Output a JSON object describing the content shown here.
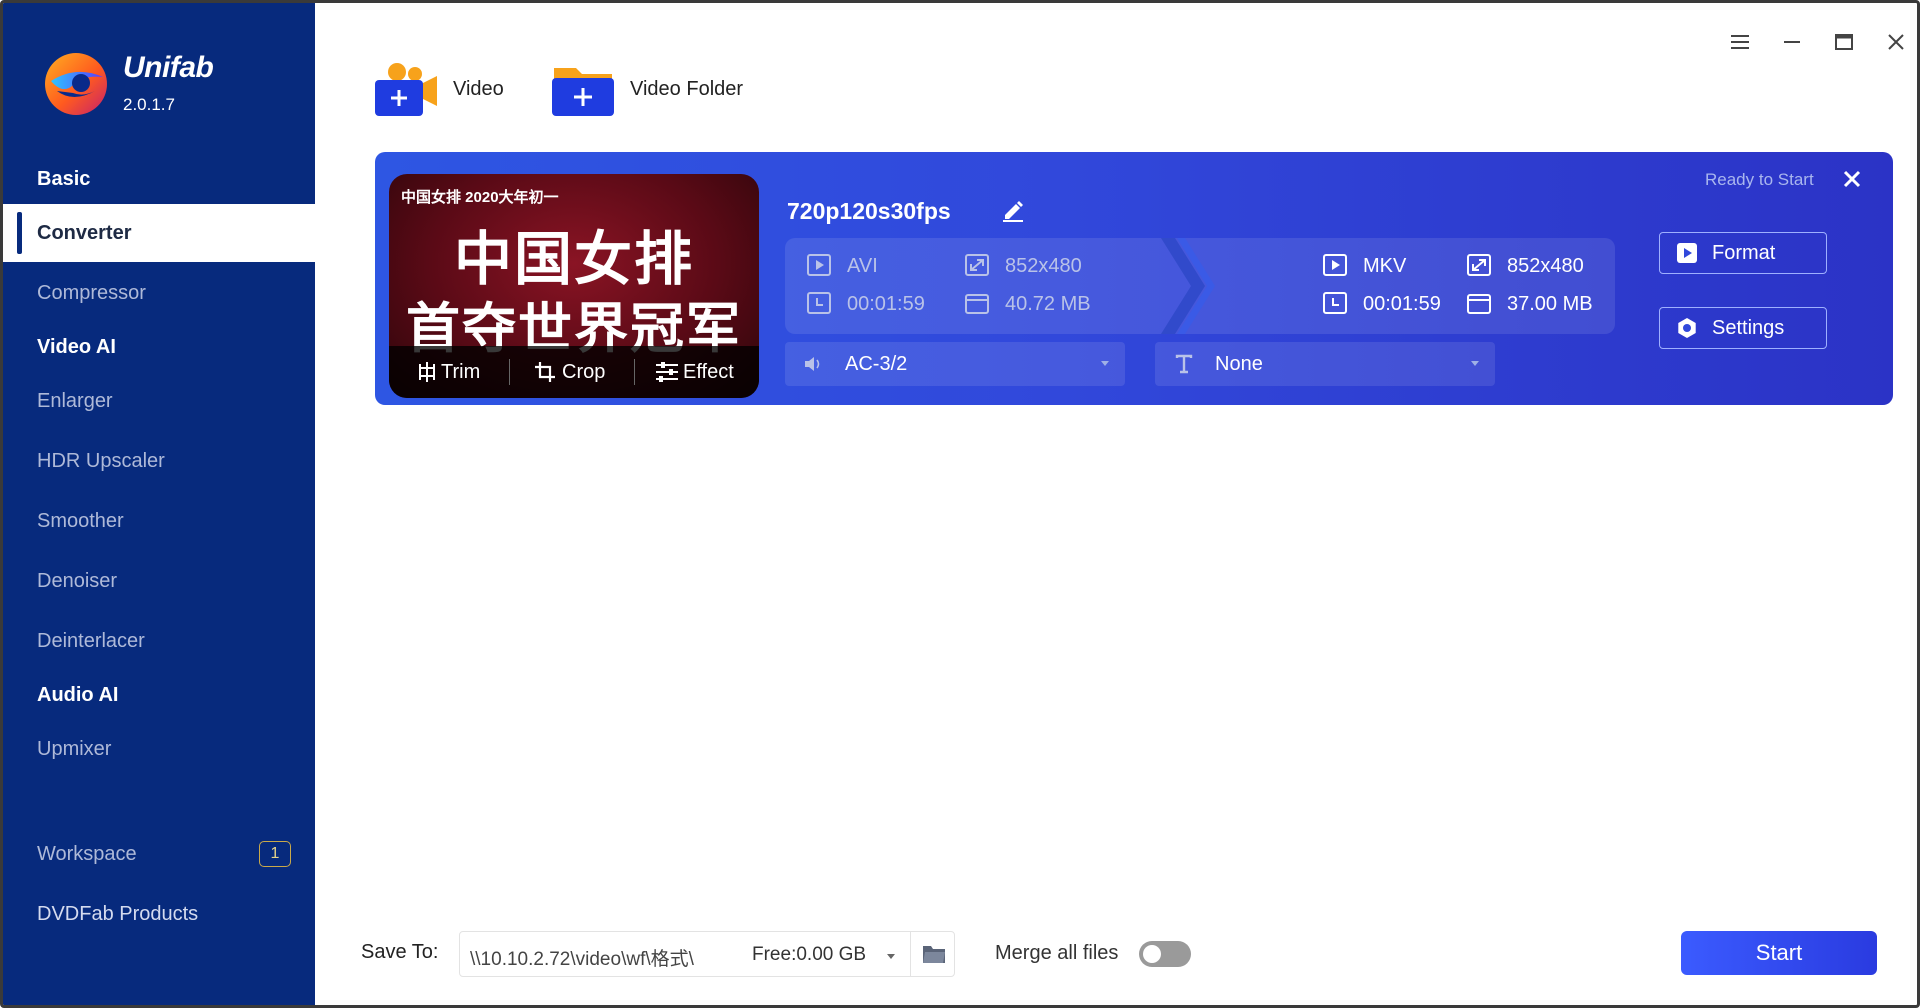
{
  "app": {
    "name": "Unifab",
    "version": "2.0.1.7"
  },
  "sidebar": {
    "sections": [
      {
        "label": "Basic"
      },
      {
        "label": "Video AI"
      },
      {
        "label": "Audio AI"
      }
    ],
    "items": [
      {
        "label": "Converter",
        "active": true
      },
      {
        "label": "Compressor"
      },
      {
        "label": "Enlarger"
      },
      {
        "label": "HDR Upscaler"
      },
      {
        "label": "Smoother"
      },
      {
        "label": "Denoiser"
      },
      {
        "label": "Deinterlacer"
      },
      {
        "label": "Upmixer"
      },
      {
        "label": "Workspace",
        "badge": "1"
      },
      {
        "label": "DVDFab Products"
      }
    ]
  },
  "toolbar": {
    "add_video_label": "Video",
    "add_folder_label": "Video Folder"
  },
  "task": {
    "thumbnail": {
      "top_caption": "中国女排 2020大年初一",
      "headline_1": "中国女排",
      "headline_2": "首夺世界冠军"
    },
    "thumb_actions": {
      "trim": "Trim",
      "crop": "Crop",
      "effect": "Effect"
    },
    "filename": "720p120s30fps",
    "status": "Ready to Start",
    "source": {
      "format": "AVI",
      "resolution": "852x480",
      "duration": "00:01:59",
      "size": "40.72 MB"
    },
    "output": {
      "format": "MKV",
      "resolution": "852x480",
      "duration": "00:01:59",
      "size": "37.00 MB"
    },
    "audio_track": "AC-3/2",
    "subtitle": "None",
    "format_button": "Format",
    "settings_button": "Settings"
  },
  "bottom": {
    "save_to_label": "Save To:",
    "save_path": "\\\\10.10.2.72\\video\\wf\\格式\\",
    "free_space": "Free:0.00 GB",
    "merge_label": "Merge all files",
    "merge_enabled": false,
    "start_button": "Start"
  },
  "colors": {
    "sidebar_bg": "#072a7d",
    "card_bg": "#3148db",
    "start_button": "#3b5bff",
    "accent_orange": "#f7a21b"
  }
}
